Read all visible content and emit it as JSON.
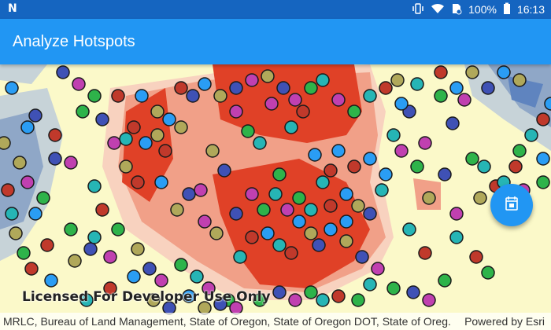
{
  "status_bar": {
    "app_icon": "N",
    "battery": "100%",
    "time": "16:13"
  },
  "app_bar": {
    "title": "Analyze Hotspots"
  },
  "map": {
    "license_text": "Licensed For Developer Use Only",
    "attribution": "MRLC, Bureau of Land Management, State of Oregon, State of Oregon DOT, State of Oreg...",
    "powered_by": "Powered by Esri",
    "point_colors": [
      "#2a9df4",
      "#3f51b5",
      "#2eb34a",
      "#c0392b",
      "#b0a85a",
      "#c040b0",
      "#26b5b5"
    ],
    "hotspot_colors": {
      "hot": "#e04127",
      "warm": "#f1a088",
      "mild": "#f8d2bf",
      "cool": "#c7d3d8",
      "cold": "#8fa7c7",
      "coldest": "#5f84bf",
      "neutral": "#fbf9c9"
    }
  },
  "fab": {
    "icon": "calendar-icon"
  }
}
